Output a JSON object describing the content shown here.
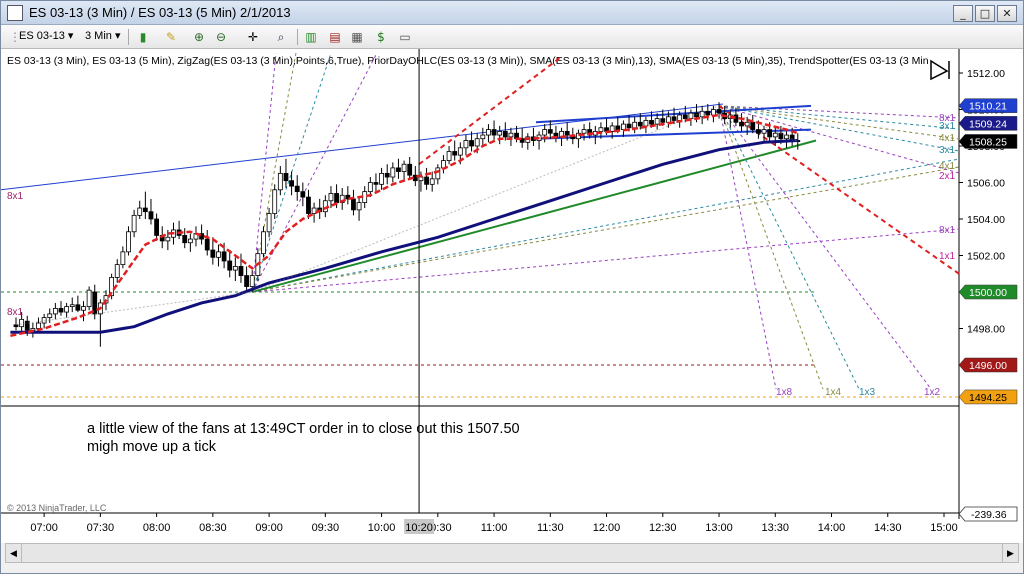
{
  "window": {
    "title": "ES 03-13 (3 Min) / ES 03-13 (5 Min)  2/1/2013",
    "min_label": "_",
    "max_label": "□",
    "close_label": "✕"
  },
  "toolbar": {
    "instrument": "ES 03-13",
    "interval": "3 Min",
    "icons": [
      "candle-style-icon",
      "draw-pencil-icon",
      "zoom-in-icon",
      "zoom-out-icon",
      "crosshair-icon",
      "magnify-icon",
      "bar-type-icon",
      "indicators-icon",
      "strategies-icon",
      "dollar-icon",
      "properties-icon"
    ]
  },
  "chart_data": {
    "type": "candlestick",
    "indicator_label": "ES 03-13 (3 Min), ES 03-13 (5 Min), ZigZag(ES 03-13 (3 Min),Points,6,True), PriorDayOHLC(ES 03-13 (3 Min)), SMA(ES 03-13 (3 Min),13), SMA(ES 03-13 (5 Min),35), TrendSpotter(ES 03-13 (3 Min",
    "copyright": "© 2013 NinjaTrader, LLC",
    "annotation": [
      "a little view of the fans at 13:49CT order in to close out this 1507.50",
      "migh move up a tick"
    ],
    "ylim": [
      1493.6,
      1512.8
    ],
    "yticks": [
      "1512.00",
      "1510.00",
      "1508.00",
      "1506.00",
      "1504.00",
      "1502.00",
      "1500.00",
      "1498.00",
      "1496.00"
    ],
    "xticks": [
      "07:00",
      "07:30",
      "08:00",
      "08:30",
      "09:00",
      "09:30",
      "10:00",
      "10:30",
      "11:00",
      "11:30",
      "12:00",
      "12:30",
      "13:00",
      "13:30",
      "14:00",
      "14:30",
      "15:00"
    ],
    "crosshair_time": "10:20",
    "price_markers": [
      {
        "value": 1510.21,
        "label": "1510.21",
        "color": "#1f3fd0"
      },
      {
        "value": 1509.24,
        "label": "1509.24",
        "color": "#1a1a8a"
      },
      {
        "value": 1508.25,
        "label": "1508.25",
        "color": "#000000"
      },
      {
        "value": 1500.0,
        "label": "1500.00",
        "color": "#1f8a2a"
      },
      {
        "value": 1496.0,
        "label": "1496.00",
        "color": "#a01818"
      },
      {
        "value": 1494.25,
        "label": "1494.25",
        "color": "#f0a010"
      }
    ],
    "lower_panel_value": "-239.36",
    "fan_labels_right": [
      "8x1",
      "3x1",
      "4x1",
      "3x1",
      "4x1",
      "2x1",
      "8x1",
      "1x1"
    ],
    "fan_labels_bottom": [
      "1x8",
      "1x4",
      "1x3",
      "1x2"
    ],
    "fan_labels_left": [
      "8x1",
      "8x1"
    ],
    "candles": [
      [
        6.75,
        1498.2,
        1498.6,
        1497.9,
        1498.1
      ],
      [
        6.8,
        1498.1,
        1498.9,
        1497.7,
        1498.5
      ],
      [
        6.85,
        1498.4,
        1498.7,
        1497.6,
        1497.9
      ],
      [
        6.9,
        1497.9,
        1498.3,
        1497.5,
        1498.0
      ],
      [
        6.95,
        1498.0,
        1498.6,
        1497.8,
        1498.3
      ],
      [
        7.0,
        1498.3,
        1498.8,
        1498.0,
        1498.6
      ],
      [
        7.05,
        1498.6,
        1499.1,
        1498.3,
        1498.8
      ],
      [
        7.1,
        1498.8,
        1499.4,
        1498.5,
        1499.1
      ],
      [
        7.15,
        1499.1,
        1499.5,
        1498.7,
        1498.9
      ],
      [
        7.2,
        1498.9,
        1499.4,
        1498.6,
        1499.2
      ],
      [
        7.25,
        1499.2,
        1499.7,
        1498.9,
        1499.3
      ],
      [
        7.3,
        1499.3,
        1499.8,
        1498.9,
        1499.0
      ],
      [
        7.35,
        1499.0,
        1499.5,
        1498.4,
        1499.2
      ],
      [
        7.4,
        1499.2,
        1500.3,
        1499.0,
        1500.1
      ],
      [
        7.45,
        1500.0,
        1500.4,
        1498.5,
        1498.8
      ],
      [
        7.5,
        1498.8,
        1499.6,
        1497.0,
        1499.4
      ],
      [
        7.55,
        1499.4,
        1500.1,
        1499.0,
        1499.8
      ],
      [
        7.6,
        1499.8,
        1501.0,
        1499.6,
        1500.8
      ],
      [
        7.65,
        1500.8,
        1501.8,
        1500.5,
        1501.5
      ],
      [
        7.7,
        1501.5,
        1502.5,
        1501.3,
        1502.2
      ],
      [
        7.75,
        1502.2,
        1503.6,
        1502.0,
        1503.3
      ],
      [
        7.8,
        1503.3,
        1504.5,
        1503.0,
        1504.2
      ],
      [
        7.85,
        1504.2,
        1505.0,
        1504.0,
        1504.6
      ],
      [
        7.9,
        1504.6,
        1505.5,
        1504.0,
        1504.4
      ],
      [
        7.95,
        1504.4,
        1505.1,
        1503.7,
        1504.0
      ],
      [
        8.0,
        1504.0,
        1504.3,
        1502.8,
        1503.1
      ],
      [
        8.05,
        1503.1,
        1503.6,
        1502.4,
        1502.8
      ],
      [
        8.1,
        1502.8,
        1503.4,
        1502.3,
        1503.0
      ],
      [
        8.15,
        1503.0,
        1503.8,
        1502.6,
        1503.4
      ],
      [
        8.2,
        1503.4,
        1503.9,
        1502.9,
        1503.1
      ],
      [
        8.25,
        1503.1,
        1503.5,
        1502.4,
        1502.7
      ],
      [
        8.3,
        1502.7,
        1503.2,
        1502.2,
        1502.9
      ],
      [
        8.35,
        1502.9,
        1503.6,
        1502.5,
        1503.2
      ],
      [
        8.4,
        1503.2,
        1503.7,
        1502.6,
        1502.9
      ],
      [
        8.45,
        1502.9,
        1503.4,
        1502.0,
        1502.3
      ],
      [
        8.5,
        1502.3,
        1503.0,
        1501.5,
        1501.9
      ],
      [
        8.55,
        1501.9,
        1502.6,
        1501.4,
        1502.2
      ],
      [
        8.6,
        1502.2,
        1502.7,
        1501.3,
        1501.7
      ],
      [
        8.65,
        1501.7,
        1502.3,
        1500.8,
        1501.2
      ],
      [
        8.7,
        1501.2,
        1501.9,
        1500.6,
        1501.4
      ],
      [
        8.75,
        1501.4,
        1502.1,
        1500.5,
        1500.9
      ],
      [
        8.8,
        1500.9,
        1501.4,
        1500.0,
        1500.3
      ],
      [
        8.85,
        1500.3,
        1501.2,
        1500.0,
        1500.9
      ],
      [
        8.9,
        1500.9,
        1502.4,
        1500.6,
        1502.1
      ],
      [
        8.95,
        1502.1,
        1503.6,
        1501.9,
        1503.3
      ],
      [
        9.0,
        1503.3,
        1504.6,
        1503.0,
        1504.3
      ],
      [
        9.05,
        1504.3,
        1505.9,
        1504.0,
        1505.6
      ],
      [
        9.1,
        1505.6,
        1506.9,
        1505.3,
        1506.5
      ],
      [
        9.15,
        1506.5,
        1507.3,
        1505.7,
        1506.1
      ],
      [
        9.2,
        1506.1,
        1506.6,
        1505.3,
        1505.8
      ],
      [
        9.25,
        1505.8,
        1506.4,
        1505.0,
        1505.5
      ],
      [
        9.3,
        1505.5,
        1506.0,
        1504.7,
        1505.2
      ],
      [
        9.35,
        1505.2,
        1505.6,
        1504.0,
        1504.3
      ],
      [
        9.4,
        1504.3,
        1504.9,
        1503.8,
        1504.6
      ],
      [
        9.45,
        1504.6,
        1505.1,
        1504.0,
        1504.4
      ],
      [
        9.5,
        1504.4,
        1505.3,
        1504.1,
        1505.0
      ],
      [
        9.55,
        1505.0,
        1505.8,
        1504.6,
        1505.4
      ],
      [
        9.6,
        1505.4,
        1505.9,
        1504.6,
        1504.9
      ],
      [
        9.65,
        1504.9,
        1505.7,
        1504.5,
        1505.3
      ],
      [
        9.7,
        1505.3,
        1505.8,
        1504.8,
        1505.1
      ],
      [
        9.75,
        1505.1,
        1505.6,
        1504.2,
        1504.5
      ],
      [
        9.8,
        1504.5,
        1505.2,
        1503.9,
        1504.9
      ],
      [
        9.85,
        1504.9,
        1505.8,
        1504.6,
        1505.5
      ],
      [
        9.9,
        1505.5,
        1506.3,
        1505.2,
        1506.0
      ],
      [
        9.95,
        1506.0,
        1506.5,
        1505.5,
        1505.9
      ],
      [
        10.0,
        1505.9,
        1506.8,
        1505.6,
        1506.5
      ],
      [
        10.05,
        1506.5,
        1507.0,
        1505.9,
        1506.3
      ],
      [
        10.1,
        1506.3,
        1507.1,
        1506.0,
        1506.8
      ],
      [
        10.15,
        1506.8,
        1507.3,
        1506.2,
        1506.6
      ],
      [
        10.2,
        1506.6,
        1507.2,
        1506.1,
        1507.0
      ],
      [
        10.25,
        1507.0,
        1507.4,
        1506.2,
        1506.4
      ],
      [
        10.3,
        1506.4,
        1506.9,
        1505.8,
        1506.1
      ],
      [
        10.35,
        1506.1,
        1506.6,
        1505.5,
        1506.3
      ],
      [
        10.4,
        1506.3,
        1506.8,
        1505.6,
        1505.9
      ],
      [
        10.45,
        1505.9,
        1506.6,
        1505.5,
        1506.2
      ],
      [
        10.5,
        1506.2,
        1507.0,
        1505.9,
        1506.8
      ],
      [
        10.55,
        1506.8,
        1507.5,
        1506.5,
        1507.2
      ],
      [
        10.6,
        1507.2,
        1508.0,
        1507.0,
        1507.7
      ],
      [
        10.65,
        1507.7,
        1508.3,
        1507.2,
        1507.5
      ],
      [
        10.7,
        1507.5,
        1508.2,
        1507.0,
        1507.9
      ],
      [
        10.75,
        1507.9,
        1508.6,
        1507.5,
        1508.3
      ],
      [
        10.8,
        1508.3,
        1508.8,
        1507.7,
        1508.0
      ],
      [
        10.85,
        1508.0,
        1508.7,
        1507.6,
        1508.4
      ],
      [
        10.9,
        1508.4,
        1509.0,
        1508.0,
        1508.6
      ],
      [
        10.95,
        1508.6,
        1509.2,
        1508.2,
        1508.9
      ],
      [
        11.0,
        1508.9,
        1509.4,
        1508.3,
        1508.6
      ],
      [
        11.05,
        1508.6,
        1509.1,
        1508.1,
        1508.8
      ],
      [
        11.1,
        1508.8,
        1509.3,
        1508.3,
        1508.5
      ],
      [
        11.15,
        1508.5,
        1509.0,
        1508.0,
        1508.7
      ],
      [
        11.2,
        1508.7,
        1509.1,
        1508.2,
        1508.4
      ],
      [
        11.25,
        1508.4,
        1509.0,
        1507.9,
        1508.2
      ],
      [
        11.3,
        1508.2,
        1508.7,
        1507.8,
        1508.5
      ],
      [
        11.35,
        1508.5,
        1509.0,
        1508.0,
        1508.3
      ],
      [
        11.4,
        1508.3,
        1508.8,
        1507.8,
        1508.6
      ],
      [
        11.45,
        1508.6,
        1509.2,
        1508.2,
        1508.9
      ],
      [
        11.5,
        1508.9,
        1509.4,
        1508.4,
        1508.7
      ],
      [
        11.55,
        1508.7,
        1509.1,
        1508.2,
        1508.5
      ],
      [
        11.6,
        1508.5,
        1509.0,
        1508.0,
        1508.8
      ],
      [
        11.65,
        1508.8,
        1509.3,
        1508.3,
        1508.6
      ],
      [
        11.7,
        1508.6,
        1509.0,
        1508.1,
        1508.4
      ],
      [
        11.75,
        1508.4,
        1508.9,
        1507.9,
        1508.7
      ],
      [
        11.8,
        1508.7,
        1509.2,
        1508.3,
        1508.9
      ],
      [
        11.85,
        1508.9,
        1509.3,
        1508.4,
        1508.6
      ],
      [
        11.9,
        1508.6,
        1509.1,
        1508.1,
        1508.8
      ],
      [
        11.95,
        1508.8,
        1509.3,
        1508.4,
        1509.0
      ],
      [
        12.0,
        1509.0,
        1509.5,
        1508.6,
        1508.8
      ],
      [
        12.05,
        1508.8,
        1509.3,
        1508.4,
        1509.1
      ],
      [
        12.1,
        1509.1,
        1509.6,
        1508.7,
        1508.9
      ],
      [
        12.15,
        1508.9,
        1509.4,
        1508.5,
        1509.2
      ],
      [
        12.2,
        1509.2,
        1509.7,
        1508.8,
        1509.0
      ],
      [
        12.25,
        1509.0,
        1509.6,
        1508.7,
        1509.3
      ],
      [
        12.3,
        1509.3,
        1509.8,
        1508.9,
        1509.1
      ],
      [
        12.35,
        1509.1,
        1509.6,
        1508.7,
        1509.4
      ],
      [
        12.4,
        1509.4,
        1509.9,
        1509.0,
        1509.2
      ],
      [
        12.45,
        1509.2,
        1509.8,
        1508.9,
        1509.5
      ],
      [
        12.5,
        1509.5,
        1510.0,
        1509.1,
        1509.3
      ],
      [
        12.55,
        1509.3,
        1509.9,
        1509.0,
        1509.6
      ],
      [
        12.6,
        1509.6,
        1510.1,
        1509.2,
        1509.4
      ],
      [
        12.65,
        1509.4,
        1509.9,
        1509.0,
        1509.7
      ],
      [
        12.7,
        1509.7,
        1510.2,
        1509.3,
        1509.5
      ],
      [
        12.75,
        1509.5,
        1510.0,
        1509.1,
        1509.8
      ],
      [
        12.8,
        1509.8,
        1510.3,
        1509.3,
        1509.6
      ],
      [
        12.85,
        1509.6,
        1510.2,
        1509.2,
        1509.9
      ],
      [
        12.9,
        1509.9,
        1510.3,
        1509.4,
        1509.7
      ],
      [
        12.95,
        1509.7,
        1510.2,
        1509.3,
        1510.0
      ],
      [
        13.0,
        1510.0,
        1510.4,
        1509.5,
        1509.8
      ],
      [
        13.05,
        1509.8,
        1510.2,
        1509.2,
        1509.5
      ],
      [
        13.1,
        1509.5,
        1510.0,
        1509.0,
        1509.7
      ],
      [
        13.15,
        1509.7,
        1510.1,
        1509.1,
        1509.3
      ],
      [
        13.2,
        1509.3,
        1509.8,
        1508.8,
        1509.1
      ],
      [
        13.25,
        1509.1,
        1509.6,
        1508.6,
        1509.3
      ],
      [
        13.3,
        1509.3,
        1509.7,
        1508.7,
        1508.9
      ],
      [
        13.35,
        1508.9,
        1509.4,
        1508.4,
        1508.7
      ],
      [
        13.4,
        1508.7,
        1509.1,
        1508.2,
        1508.9
      ],
      [
        13.45,
        1508.9,
        1509.3,
        1508.3,
        1508.5
      ],
      [
        13.5,
        1508.5,
        1509.0,
        1508.0,
        1508.7
      ],
      [
        13.55,
        1508.7,
        1509.1,
        1508.1,
        1508.4
      ],
      [
        13.6,
        1508.4,
        1508.8,
        1507.9,
        1508.6
      ],
      [
        13.65,
        1508.6,
        1509.0,
        1508.0,
        1508.3
      ],
      [
        13.7,
        1508.3,
        1508.7,
        1507.8,
        1508.25
      ]
    ],
    "sma13": [
      [
        6.7,
        1497.6
      ],
      [
        7.0,
        1498.0
      ],
      [
        7.3,
        1498.6
      ],
      [
        7.5,
        1499.1
      ],
      [
        7.75,
        1501.3
      ],
      [
        7.9,
        1502.6
      ],
      [
        8.1,
        1503.2
      ],
      [
        8.3,
        1503.3
      ],
      [
        8.5,
        1502.9
      ],
      [
        8.7,
        1502.0
      ],
      [
        8.85,
        1501.3
      ],
      [
        9.0,
        1502.0
      ],
      [
        9.15,
        1503.3
      ],
      [
        9.3,
        1504.0
      ],
      [
        9.5,
        1504.6
      ],
      [
        9.7,
        1505.1
      ],
      [
        9.9,
        1505.3
      ],
      [
        10.1,
        1505.9
      ],
      [
        10.3,
        1506.3
      ],
      [
        10.5,
        1506.6
      ],
      [
        10.7,
        1507.2
      ],
      [
        10.9,
        1508.0
      ],
      [
        11.05,
        1508.4
      ],
      [
        11.3,
        1508.4
      ],
      [
        11.6,
        1508.5
      ],
      [
        11.9,
        1508.7
      ],
      [
        12.2,
        1508.9
      ],
      [
        12.5,
        1509.2
      ],
      [
        12.8,
        1509.5
      ],
      [
        13.0,
        1509.7
      ],
      [
        13.2,
        1509.5
      ],
      [
        13.4,
        1509.2
      ],
      [
        13.6,
        1508.9
      ],
      [
        13.7,
        1508.7
      ]
    ],
    "sma35": [
      [
        6.7,
        1497.8
      ],
      [
        7.5,
        1497.8
      ],
      [
        7.8,
        1498.1
      ],
      [
        8.1,
        1498.8
      ],
      [
        8.4,
        1499.4
      ],
      [
        8.7,
        1499.8
      ],
      [
        9.0,
        1500.5
      ],
      [
        9.5,
        1501.3
      ],
      [
        10.0,
        1502.2
      ],
      [
        10.5,
        1503.0
      ],
      [
        11.0,
        1504.0
      ],
      [
        11.5,
        1505.0
      ],
      [
        12.0,
        1506.0
      ],
      [
        12.5,
        1507.0
      ],
      [
        13.0,
        1507.8
      ],
      [
        13.4,
        1508.2
      ],
      [
        13.7,
        1508.3
      ]
    ],
    "zigzag": [
      [
        6.75,
        1498.2
      ],
      [
        8.85,
        1500.0
      ],
      [
        13.0,
        1510.2
      ],
      [
        13.7,
        1508.25
      ]
    ]
  }
}
